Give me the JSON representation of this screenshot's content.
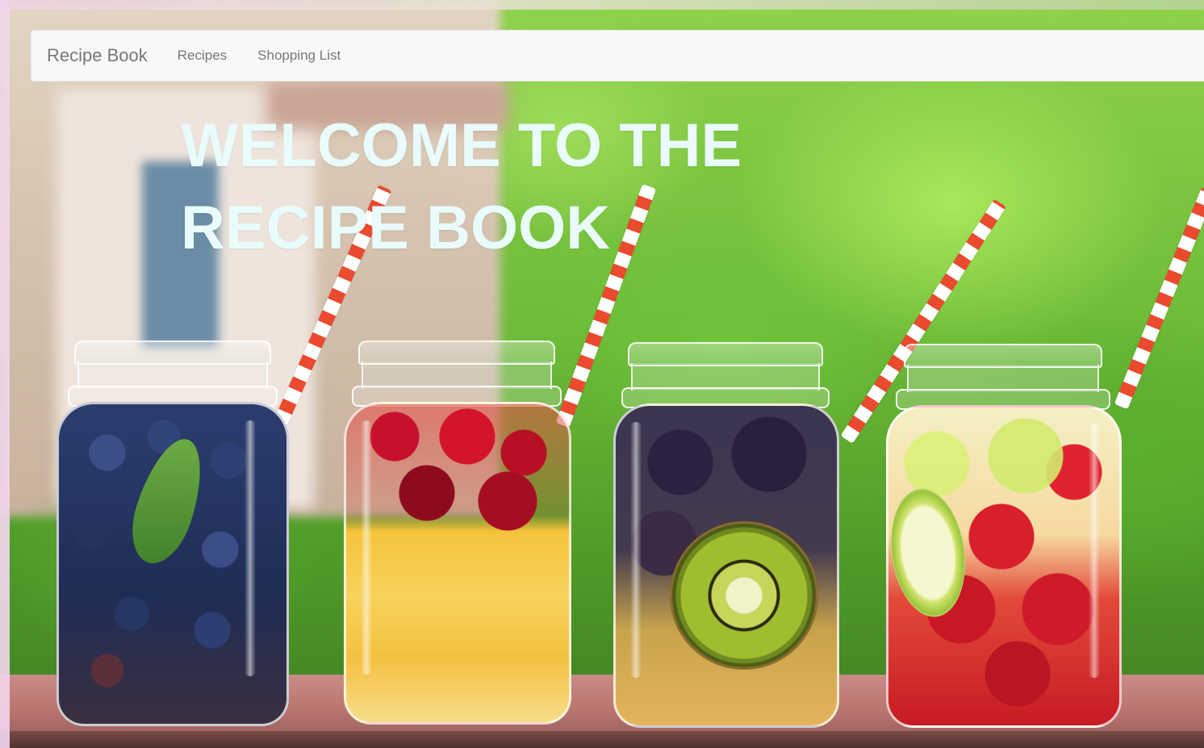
{
  "navbar": {
    "brand": "Recipe Book",
    "links": [
      {
        "label": "Recipes"
      },
      {
        "label": "Shopping List"
      }
    ]
  },
  "hero": {
    "title": "WELCOME TO THE RECIPE BOOK"
  },
  "colors": {
    "navbar_bg": "#f8f8f8",
    "nav_text": "#777777",
    "hero_text": "#e9fbfb",
    "straw_red": "#ea4a2e"
  },
  "background": {
    "subject": "four-mason-jars-fruit-infused-water"
  }
}
